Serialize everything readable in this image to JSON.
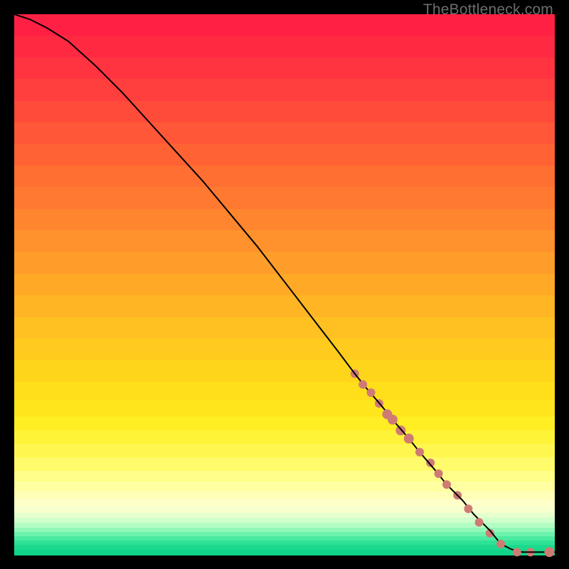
{
  "watermark": "TheBottleneck.com",
  "palette": {
    "marker": "#cf7b74",
    "line": "#000000"
  },
  "chart_data": {
    "type": "line",
    "title": "",
    "xlabel": "",
    "ylabel": "",
    "xlim": [
      0,
      100
    ],
    "ylim": [
      0,
      100
    ],
    "grid": false,
    "legend": false,
    "series": [
      {
        "name": "curve",
        "kind": "line",
        "x": [
          0,
          3,
          6,
          10,
          15,
          20,
          25,
          30,
          35,
          40,
          45,
          50,
          55,
          60,
          63,
          65,
          68,
          70,
          73,
          75,
          78,
          80,
          83,
          85,
          88,
          90,
          92,
          94,
          96,
          100
        ],
        "y": [
          100,
          99,
          97.5,
          95,
          90.5,
          85.5,
          80,
          74.5,
          69,
          63,
          57,
          50.5,
          44,
          37.5,
          33.5,
          31,
          27.5,
          25,
          21.5,
          19,
          15.5,
          13,
          10,
          7.5,
          4.5,
          2,
          1,
          0.5,
          0.5,
          0.5
        ]
      },
      {
        "name": "markers",
        "kind": "scatter",
        "points": [
          {
            "x": 63,
            "y": 33.5,
            "r": 6
          },
          {
            "x": 64.5,
            "y": 31.5,
            "r": 6
          },
          {
            "x": 66,
            "y": 30,
            "r": 6
          },
          {
            "x": 67.5,
            "y": 28,
            "r": 6
          },
          {
            "x": 69,
            "y": 26,
            "r": 7
          },
          {
            "x": 70,
            "y": 25,
            "r": 7
          },
          {
            "x": 71.5,
            "y": 23,
            "r": 7
          },
          {
            "x": 73,
            "y": 21.5,
            "r": 7
          },
          {
            "x": 75,
            "y": 19,
            "r": 6
          },
          {
            "x": 77,
            "y": 17,
            "r": 6
          },
          {
            "x": 78.5,
            "y": 15,
            "r": 6
          },
          {
            "x": 80,
            "y": 13,
            "r": 6
          },
          {
            "x": 82,
            "y": 11,
            "r": 6
          },
          {
            "x": 84,
            "y": 8.5,
            "r": 6
          },
          {
            "x": 86,
            "y": 6,
            "r": 6
          },
          {
            "x": 88,
            "y": 4,
            "r": 6
          },
          {
            "x": 90,
            "y": 2,
            "r": 6
          },
          {
            "x": 93,
            "y": 0.5,
            "r": 6
          },
          {
            "x": 95.5,
            "y": 0.5,
            "r": 6
          },
          {
            "x": 99,
            "y": 0.5,
            "r": 7
          }
        ]
      }
    ],
    "gradient_bands": [
      {
        "top": 0.0,
        "h": 0.04,
        "c": "#ff2044"
      },
      {
        "top": 0.04,
        "h": 0.04,
        "c": "#ff2a42"
      },
      {
        "top": 0.08,
        "h": 0.04,
        "c": "#ff3440"
      },
      {
        "top": 0.12,
        "h": 0.04,
        "c": "#ff3f3d"
      },
      {
        "top": 0.16,
        "h": 0.04,
        "c": "#ff4b3a"
      },
      {
        "top": 0.2,
        "h": 0.04,
        "c": "#ff5737"
      },
      {
        "top": 0.24,
        "h": 0.04,
        "c": "#ff6334"
      },
      {
        "top": 0.28,
        "h": 0.04,
        "c": "#ff6f32"
      },
      {
        "top": 0.32,
        "h": 0.04,
        "c": "#ff7a30"
      },
      {
        "top": 0.36,
        "h": 0.04,
        "c": "#ff862e"
      },
      {
        "top": 0.4,
        "h": 0.04,
        "c": "#ff922c"
      },
      {
        "top": 0.44,
        "h": 0.04,
        "c": "#ff9d2a"
      },
      {
        "top": 0.48,
        "h": 0.04,
        "c": "#ffa927"
      },
      {
        "top": 0.52,
        "h": 0.04,
        "c": "#ffb524"
      },
      {
        "top": 0.56,
        "h": 0.04,
        "c": "#ffc021"
      },
      {
        "top": 0.6,
        "h": 0.04,
        "c": "#ffcb1e"
      },
      {
        "top": 0.64,
        "h": 0.04,
        "c": "#ffd51c"
      },
      {
        "top": 0.68,
        "h": 0.035,
        "c": "#ffde1a"
      },
      {
        "top": 0.715,
        "h": 0.03,
        "c": "#ffe61c"
      },
      {
        "top": 0.745,
        "h": 0.025,
        "c": "#ffee24"
      },
      {
        "top": 0.77,
        "h": 0.025,
        "c": "#fff338"
      },
      {
        "top": 0.795,
        "h": 0.025,
        "c": "#fff74f"
      },
      {
        "top": 0.82,
        "h": 0.025,
        "c": "#fffb6a"
      },
      {
        "top": 0.845,
        "h": 0.02,
        "c": "#fffe88"
      },
      {
        "top": 0.865,
        "h": 0.018,
        "c": "#ffffa2"
      },
      {
        "top": 0.883,
        "h": 0.015,
        "c": "#ffffb8"
      },
      {
        "top": 0.898,
        "h": 0.013,
        "c": "#ffffc9"
      },
      {
        "top": 0.911,
        "h": 0.011,
        "c": "#f7ffce"
      },
      {
        "top": 0.922,
        "h": 0.01,
        "c": "#e6ffcf"
      },
      {
        "top": 0.932,
        "h": 0.009,
        "c": "#d0ffcc"
      },
      {
        "top": 0.941,
        "h": 0.009,
        "c": "#b2fdc3"
      },
      {
        "top": 0.95,
        "h": 0.008,
        "c": "#90f8b8"
      },
      {
        "top": 0.958,
        "h": 0.008,
        "c": "#6cf2ad"
      },
      {
        "top": 0.966,
        "h": 0.008,
        "c": "#4beaa1"
      },
      {
        "top": 0.974,
        "h": 0.008,
        "c": "#2fe296"
      },
      {
        "top": 0.982,
        "h": 0.009,
        "c": "#1cda8d"
      },
      {
        "top": 0.991,
        "h": 0.009,
        "c": "#10d487"
      }
    ]
  }
}
